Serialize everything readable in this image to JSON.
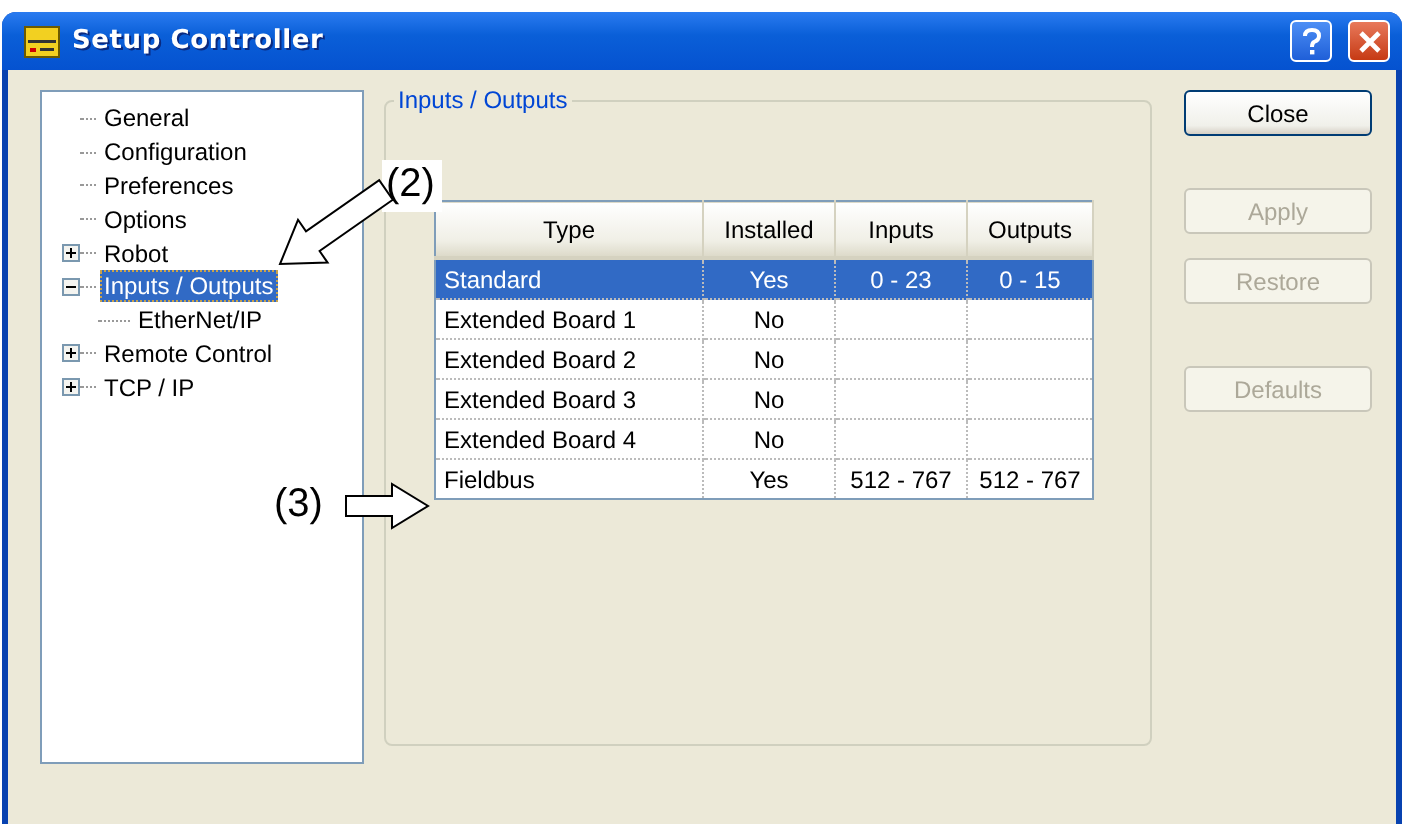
{
  "window": {
    "title": "Setup Controller"
  },
  "tree": [
    {
      "label": "General",
      "selected": false
    },
    {
      "label": "Configuration",
      "selected": false
    },
    {
      "label": "Preferences",
      "selected": false
    },
    {
      "label": "Options",
      "selected": false
    },
    {
      "label": "Robot",
      "selected": false,
      "expanded": false
    },
    {
      "label": "Inputs / Outputs",
      "selected": true,
      "expanded": true,
      "children": [
        {
          "label": "EtherNet/IP",
          "selected": false
        }
      ]
    },
    {
      "label": "Remote Control",
      "selected": false,
      "expanded": false
    },
    {
      "label": "TCP / IP",
      "selected": false,
      "expanded": false
    }
  ],
  "group": {
    "title": "Inputs / Outputs"
  },
  "table": {
    "columns": [
      "Type",
      "Installed",
      "Inputs",
      "Outputs"
    ],
    "rows": [
      {
        "cells": [
          "Standard",
          "Yes",
          "0 - 23",
          "0 - 15"
        ],
        "selected": true
      },
      {
        "cells": [
          "Extended Board 1",
          "No",
          "",
          ""
        ],
        "selected": false
      },
      {
        "cells": [
          "Extended Board 2",
          "No",
          "",
          ""
        ],
        "selected": false
      },
      {
        "cells": [
          "Extended Board 3",
          "No",
          "",
          ""
        ],
        "selected": false
      },
      {
        "cells": [
          "Extended Board 4",
          "No",
          "",
          ""
        ],
        "selected": false
      },
      {
        "cells": [
          "Fieldbus",
          "Yes",
          "512 - 767",
          "512 - 767"
        ],
        "selected": false
      }
    ]
  },
  "buttons": [
    {
      "label": "Close",
      "disabled": false
    },
    {
      "label": "Apply",
      "disabled": true
    },
    {
      "label": "Restore",
      "disabled": true
    },
    {
      "label": "Defaults",
      "disabled": true
    }
  ],
  "annotations": [
    {
      "label": "(2)",
      "kind": "diagonal"
    },
    {
      "label": "(3)",
      "kind": "right"
    }
  ]
}
